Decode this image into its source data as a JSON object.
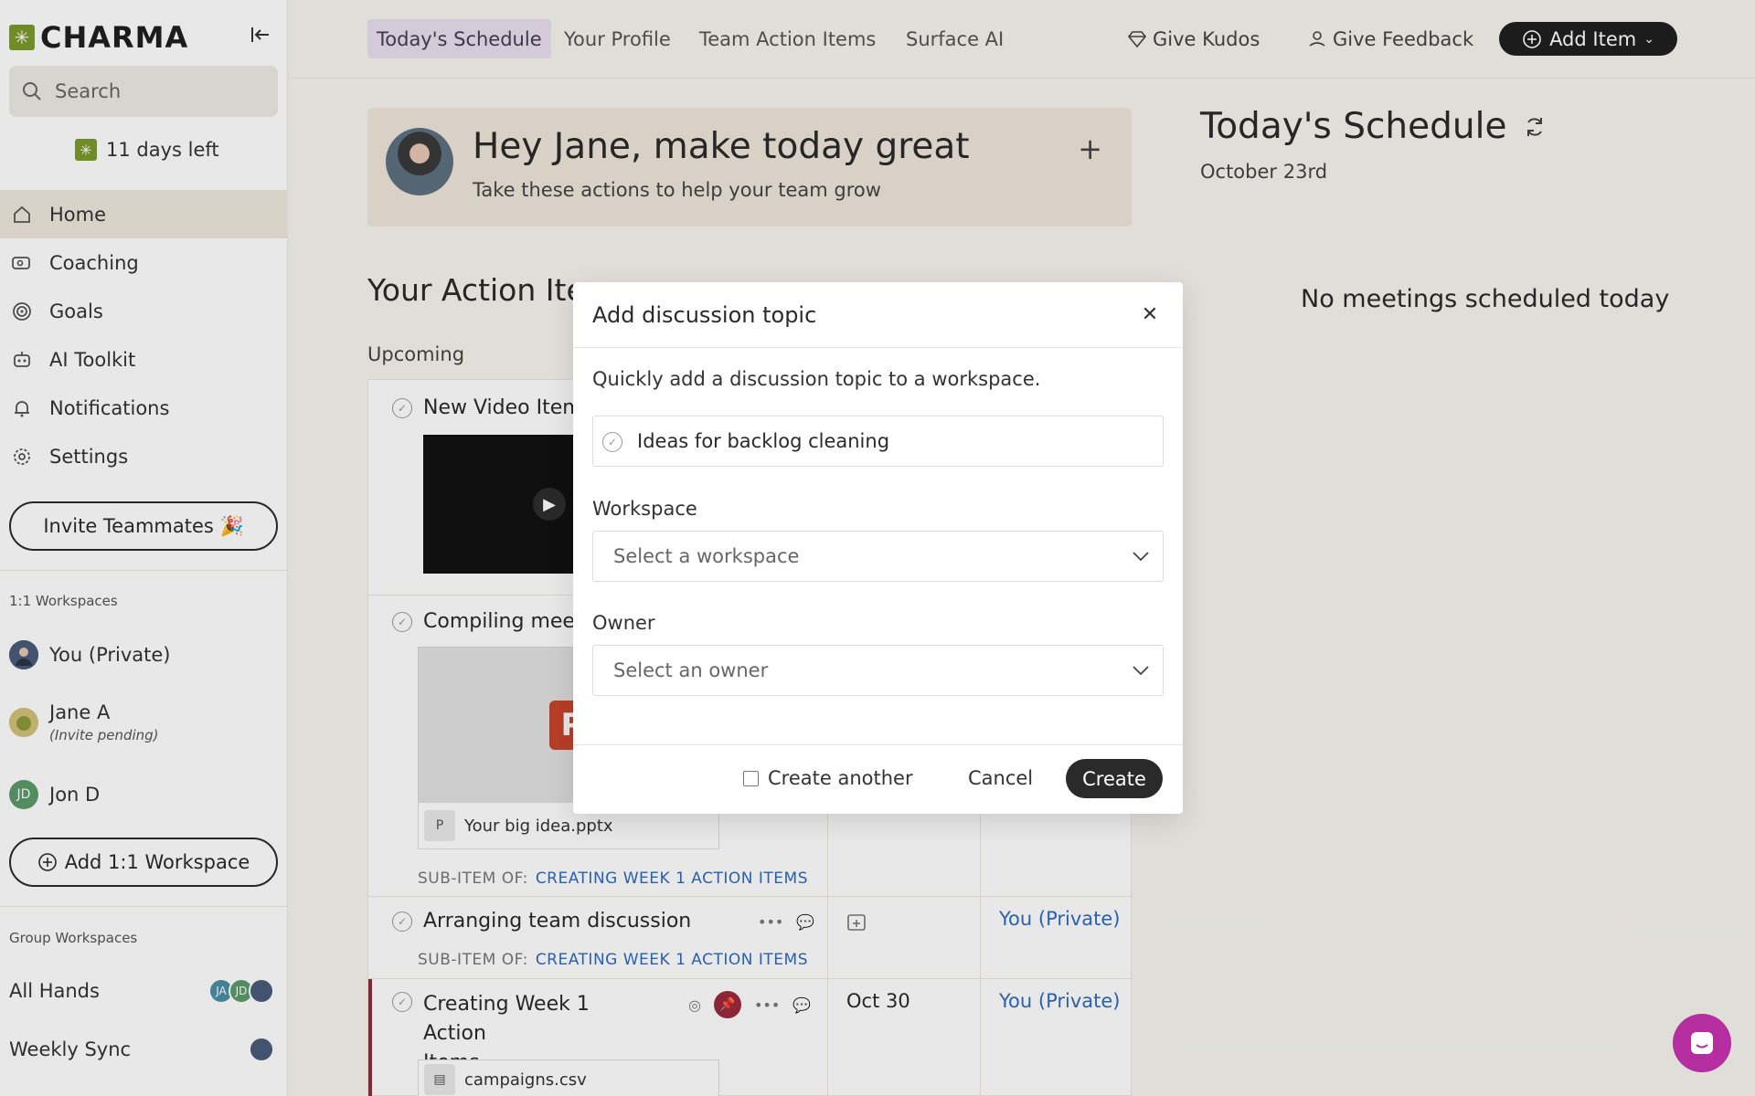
{
  "brand": {
    "name": "CHARMA",
    "accent": "#7a9a2e"
  },
  "sidebar": {
    "search_placeholder": "Search",
    "trial_text": "11 days left",
    "nav": [
      {
        "label": "Home",
        "icon": "home-icon",
        "active": true
      },
      {
        "label": "Coaching",
        "icon": "coaching-icon"
      },
      {
        "label": "Goals",
        "icon": "target-icon"
      },
      {
        "label": "AI Toolkit",
        "icon": "robot-icon"
      },
      {
        "label": "Notifications",
        "icon": "bell-icon"
      },
      {
        "label": "Settings",
        "icon": "gear-icon"
      }
    ],
    "invite_label": "Invite Teammates 🎉",
    "one_on_one_label": "1:1 Workspaces",
    "one_on_one": [
      {
        "name": "You (Private)"
      },
      {
        "name": "Jane A",
        "sub": "(Invite pending)"
      },
      {
        "name": "Jon D",
        "initials": "JD"
      }
    ],
    "add_workspace_label": "Add 1:1 Workspace",
    "group_label": "Group Workspaces",
    "groups": [
      {
        "name": "All Hands",
        "avatars": [
          "JA",
          "JD"
        ]
      },
      {
        "name": "Weekly Sync"
      }
    ]
  },
  "topnav": {
    "tabs": [
      "Today's Schedule",
      "Your Profile",
      "Team Action Items",
      "Surface AI"
    ],
    "give_kudos": "Give Kudos",
    "give_feedback": "Give Feedback",
    "add_item": "Add Item"
  },
  "greeting": {
    "title": "Hey Jane, make today great",
    "subtitle": "Take these actions to help your team grow",
    "plus": "+"
  },
  "actions": {
    "title": "Your Action Items",
    "upcoming": "Upcoming",
    "items": [
      {
        "title": "New Video Item"
      },
      {
        "title": "Compiling meeting",
        "file": "Your big idea.pptx",
        "sub_prefix": "SUB-ITEM OF:",
        "sub_link": "CREATING WEEK 1 ACTION ITEMS"
      },
      {
        "title": "Arranging team discussion",
        "sub_prefix": "SUB-ITEM OF:",
        "sub_link": "CREATING WEEK 1 ACTION ITEMS",
        "owner": "You (Private)"
      },
      {
        "title_line1": "Creating Week 1 Action",
        "title_line2": "Items",
        "date": "Oct 30",
        "owner": "You (Private)",
        "file": "campaigns.csv"
      }
    ]
  },
  "schedule": {
    "title": "Today's Schedule",
    "date": "October 23rd",
    "empty": "No meetings scheduled today"
  },
  "modal": {
    "title": "Add discussion topic",
    "description": "Quickly add a discussion topic to a workspace.",
    "topic_value": "Ideas for backlog cleaning",
    "workspace_label": "Workspace",
    "workspace_placeholder": "Select a workspace",
    "owner_label": "Owner",
    "owner_placeholder": "Select an owner",
    "create_another": "Create another",
    "cancel": "Cancel",
    "create": "Create"
  }
}
